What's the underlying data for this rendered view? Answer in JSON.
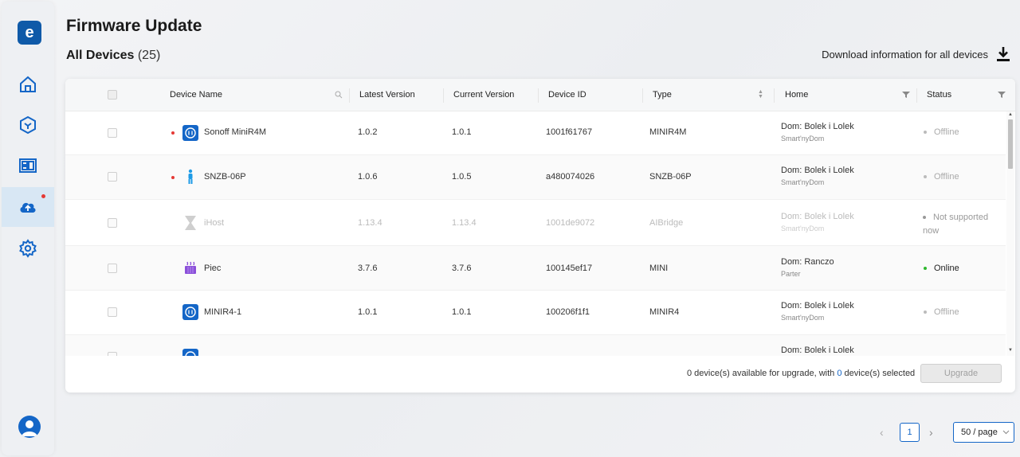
{
  "app": {
    "logo_letter": "e",
    "accent_color": "#1466c7",
    "brand_color": "#0f5aa8"
  },
  "sidebar": {
    "items": [
      {
        "name": "home",
        "icon": "home-icon",
        "active": false
      },
      {
        "name": "devices",
        "icon": "cube-icon",
        "active": false
      },
      {
        "name": "dashboard",
        "icon": "dashboard-icon",
        "active": false
      },
      {
        "name": "firmware-update",
        "icon": "cloud-upload-icon",
        "active": true,
        "badge": true
      },
      {
        "name": "settings",
        "icon": "gear-icon",
        "active": false
      }
    ],
    "avatar_icon": "user-avatar-icon"
  },
  "page": {
    "title": "Firmware Update",
    "subtitle": "All Devices",
    "count": "(25)",
    "download_label": "Download information for all devices"
  },
  "table": {
    "columns": {
      "device_name": "Device Name",
      "latest_version": "Latest Version",
      "current_version": "Current Version",
      "device_id": "Device ID",
      "type": "Type",
      "home": "Home",
      "status": "Status"
    },
    "rows": [
      {
        "name": "Sonoff MiniR4M",
        "icon": "switch-module-icon",
        "has_update": true,
        "latest": "1.0.2",
        "current": "1.0.1",
        "id": "1001f61767",
        "type": "MINIR4M",
        "home": "Dom: Bolek i Lolek",
        "room": "Smart'nyDom",
        "status": "Offline",
        "status_color": "#bbbbbb",
        "disabled": false
      },
      {
        "name": "SNZB-06P",
        "icon": "presence-sensor-icon",
        "has_update": true,
        "latest": "1.0.6",
        "current": "1.0.5",
        "id": "a480074026",
        "type": "SNZB-06P",
        "home": "Dom: Bolek i Lolek",
        "room": "Smart'nyDom",
        "status": "Offline",
        "status_color": "#bbbbbb",
        "disabled": false
      },
      {
        "name": "iHost",
        "icon": "hub-icon",
        "has_update": false,
        "latest": "1.13.4",
        "current": "1.13.4",
        "id": "1001de9072",
        "type": "AIBridge",
        "home": "Dom: Bolek i Lolek",
        "room": "Smart'nyDom",
        "status": "Not supported",
        "status_line2": "now",
        "status_color": "#999999",
        "disabled": true
      },
      {
        "name": "Piec",
        "icon": "heater-icon",
        "has_update": false,
        "latest": "3.7.6",
        "current": "3.7.6",
        "id": "100145ef17",
        "type": "MINI",
        "home": "Dom: Ranczo",
        "room": "Parter",
        "status": "Online",
        "status_color": "#2eb82e",
        "disabled": false
      },
      {
        "name": "MINIR4-1",
        "icon": "switch-module-icon",
        "has_update": false,
        "latest": "1.0.1",
        "current": "1.0.1",
        "id": "100206f1f1",
        "type": "MINIR4",
        "home": "Dom: Bolek i Lolek",
        "room": "Smart'nyDom",
        "status": "Offline",
        "status_color": "#bbbbbb",
        "disabled": false
      },
      {
        "name": "",
        "icon": "switch-module-icon",
        "has_update": false,
        "latest": "",
        "current": "",
        "id": "",
        "type": "",
        "home": "Dom: Bolek i Lolek",
        "room": "",
        "status": "",
        "status_color": "#bbbbbb",
        "disabled": false
      }
    ]
  },
  "footer": {
    "available_count": "0",
    "available_text": " device(s) available for upgrade, with ",
    "selected_count": "0",
    "selected_text": " device(s) selected",
    "upgrade_label": "Upgrade"
  },
  "pagination": {
    "prev": "‹",
    "current_page": "1",
    "next": "›",
    "page_size": "50 / page"
  }
}
